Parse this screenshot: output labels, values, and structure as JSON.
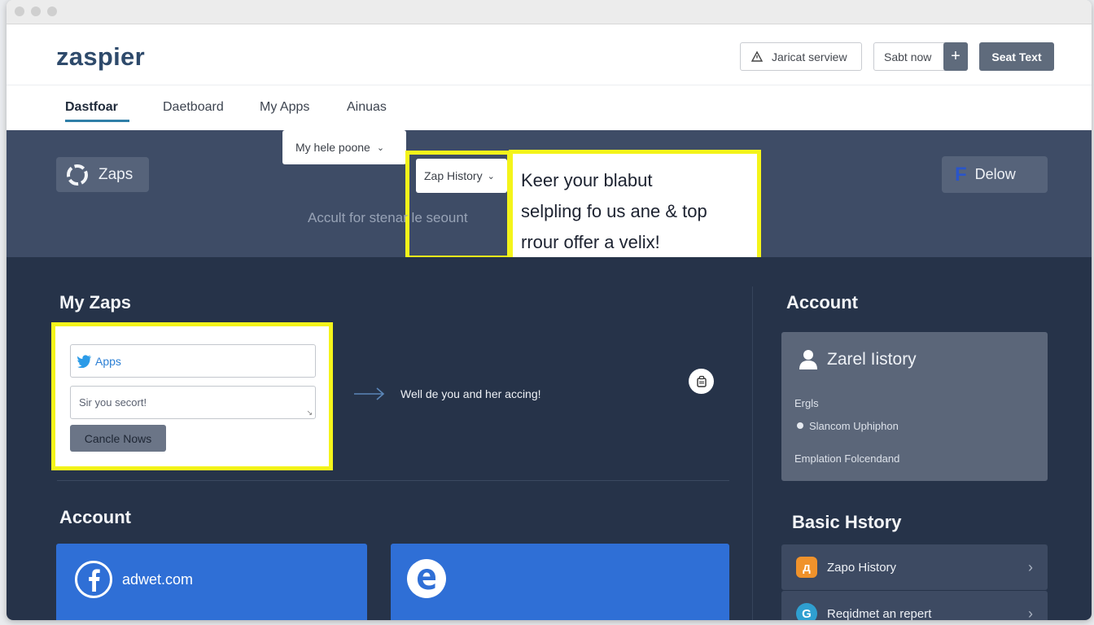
{
  "app": {
    "logo": "zaspier"
  },
  "header": {
    "service_button": "Jaricat serview",
    "start_button": "Sabt now",
    "plus_label": "+",
    "seat_text_button": "Seat Text"
  },
  "nav": {
    "items": [
      {
        "label": "Dastfoar",
        "active": true
      },
      {
        "label": "Daetboard"
      },
      {
        "label": "My Apps"
      },
      {
        "label": "Ainuas"
      }
    ]
  },
  "banner": {
    "zaps_label": "Zaps",
    "dropdown_1": "My hele poone",
    "dropdown_2": "Zap History",
    "subtitle": "Accult for stenar le seount",
    "tooltip_lines": [
      "Keer your blabut",
      "selpling fo us ane & top",
      "rrour offer a velix!"
    ],
    "deflow_label": "Delow"
  },
  "my_zaps": {
    "title": "My Zaps",
    "apps_input": "Apps",
    "textarea_placeholder": "Sir you secort!",
    "cancel_button": "Cancle Nows",
    "flow_text": "Well de you and her accing!"
  },
  "account_left": {
    "title": "Account",
    "cards": [
      {
        "icon": "facebook-icon",
        "label": "adwet.com"
      },
      {
        "icon": "edge-icon",
        "label": ""
      }
    ]
  },
  "account_right": {
    "title": "Account",
    "card_title": "Zarel Iistory",
    "line_1": "Ergls",
    "line_2": "Slancom Uphiphon",
    "line_3": "Emplation Folcendand"
  },
  "basic_history": {
    "title": "Basic Hstory",
    "rows": [
      {
        "icon": "zap-icon",
        "color": "#f0922b",
        "label": "Zapo History"
      },
      {
        "icon": "g-icon",
        "color": "#2f9fd0",
        "label": "Reqidmet an repert"
      }
    ]
  },
  "colors": {
    "highlight": "#f4f41a",
    "banner": "#3e4c66",
    "main_bg": "#263349",
    "accent_blue": "#2f6fd6"
  }
}
